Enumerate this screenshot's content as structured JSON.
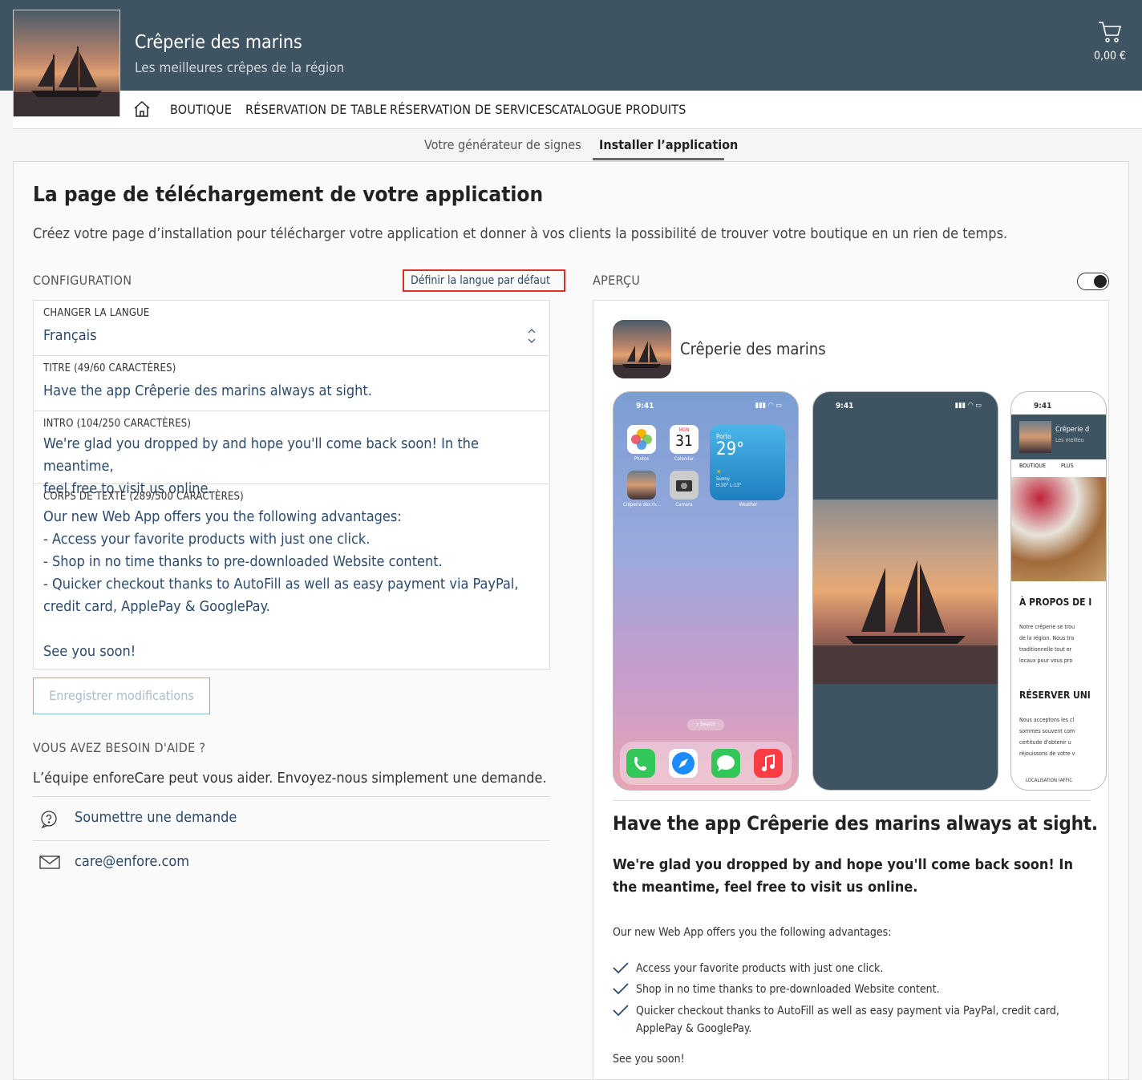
{
  "header": {
    "shop_name": "Crêperie des marins",
    "tagline": "Les meilleures crêpes de la région",
    "cart_total": "0,00 €"
  },
  "nav": {
    "items": [
      "BOUTIQUE",
      "RÉSERVATION DE TABLE",
      "RÉSERVATION DE SERVICES",
      "CATALOGUE PRODUITS"
    ]
  },
  "subnav": {
    "items": [
      "Votre générateur de signes",
      "Installer l’application"
    ],
    "active": "Installer l’application"
  },
  "page": {
    "title": "La page de téléchargement de votre application",
    "lead": "Créez votre page d’installation pour télécharger votre application et donner à vos clients la possibilité de trouver votre boutique en un rien de temps."
  },
  "config": {
    "label": "CONFIGURATION",
    "default_lang_button": "Définir la langue par défaut",
    "language": {
      "label": "CHANGER LA LANGUE",
      "value": "Français"
    },
    "title_field": {
      "label": "TITRE (49/60 CARACTÈRES)",
      "value": "Have the app Crêperie des marins always at sight."
    },
    "intro_field": {
      "label": "INTRO (104/250 CARACTÈRES)",
      "value": "We're glad you dropped by and hope you'll come back soon! In the meantime,\nfeel free to visit us online."
    },
    "body_field": {
      "label": "CORPS DE TEXTE (289/500 CARACTÈRES)",
      "value": "Our new Web App offers you the following advantages:\n- Access your favorite products with just one click.\n- Shop in no time thanks to pre-downloaded Website content.\n- Quicker checkout thanks to AutoFill as well as easy payment via PayPal,\ncredit card, ApplePay & GooglePay.\n\nSee you soon!"
    },
    "save_button": "Enregistrer modifications"
  },
  "help": {
    "label": "VOUS AVEZ BESOIN D'AIDE ?",
    "text": "L’équipe enforeCare peut vous aider. Envoyez-nous simplement une demande.",
    "submit": "Soumettre une demande",
    "email": "care@enfore.com"
  },
  "preview": {
    "label": "APERÇU",
    "app_name": "Crêperie des marins",
    "phone_time": "9:41",
    "home_apps": {
      "photos": "Photos",
      "calendar": "Calendar",
      "calendar_day": "MON",
      "calendar_date": "31",
      "shop": "Crêperie des m...",
      "camera": "Camera",
      "weather": "Weather",
      "weather_city": "Porto",
      "weather_temp": "29°",
      "weather_desc": "Sunny",
      "weather_range": "H:30° L:13°",
      "search": "Search"
    },
    "web": {
      "nav1": "BOUTIQUE",
      "nav2": "PLUS",
      "shop_name": "Crêperie d",
      "shop_tag": "Les meilleu",
      "about_title": "À PROPOS DE I",
      "about_text": "Notre crêperie se trou\nde la région. Nous tra\ntraditionnelle tout er\nlocaux pour vous pro",
      "reserve_title": "RÉSERVER UNI",
      "reserve_text": "Nous acceptons les cl\nsommes souvent com\ncertitude d'obtenir u\nréjouissons de votre v",
      "location": "LOCALISATION (AFFIC"
    },
    "heading": "Have the app Crêperie des marins always at sight.",
    "intro": "We're glad you dropped by and hope you'll come back soon! In the meantime, feel free to visit us online.",
    "body_intro": "Our new Web App offers you the following advantages:",
    "advantages": [
      "Access your favorite products with just one click.",
      "Shop in no time thanks to pre-downloaded Website content.",
      "Quicker checkout thanks to AutoFill as well as easy payment via PayPal, credit card, ApplePay & GooglePay."
    ],
    "outro": "See you soon!"
  }
}
